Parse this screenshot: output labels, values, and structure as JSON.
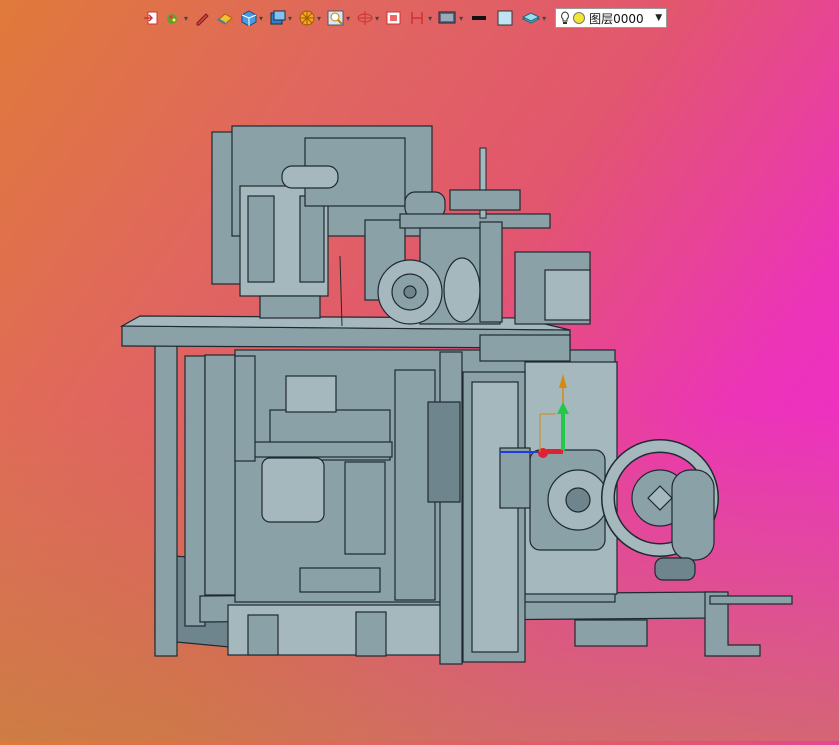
{
  "toolbar": {
    "icons": [
      {
        "name": "exit-sketch-icon",
        "color": "#d33"
      },
      {
        "name": "paint-icon",
        "color": "#6a9a3a"
      },
      {
        "name": "pencil-icon",
        "color": "#c44"
      },
      {
        "name": "eraser-icon",
        "color": "#e0a020"
      },
      {
        "name": "cube-view-icon",
        "color": "#2f7fd0"
      },
      {
        "name": "standard-views-icon",
        "color": "#2f7fd0"
      },
      {
        "name": "render-icon",
        "color": "#e68a12"
      },
      {
        "name": "zoom-icon",
        "color": "#5a8ab0"
      },
      {
        "name": "orbit-icon",
        "color": "#c33"
      },
      {
        "name": "section-icon",
        "color": "#c33"
      },
      {
        "name": "plane-icon",
        "color": "#c33"
      },
      {
        "name": "display-mode-icon",
        "color": "#555"
      },
      {
        "name": "line-weight-icon",
        "color": "#111"
      },
      {
        "name": "color-swatch-icon",
        "color": "#bfe3f0"
      },
      {
        "name": "layer-manager-icon",
        "color": "#3aa"
      }
    ],
    "layer_name": "图层0000"
  },
  "colors": {
    "model": "#8aa1a8",
    "edges": "#1e2a30"
  }
}
